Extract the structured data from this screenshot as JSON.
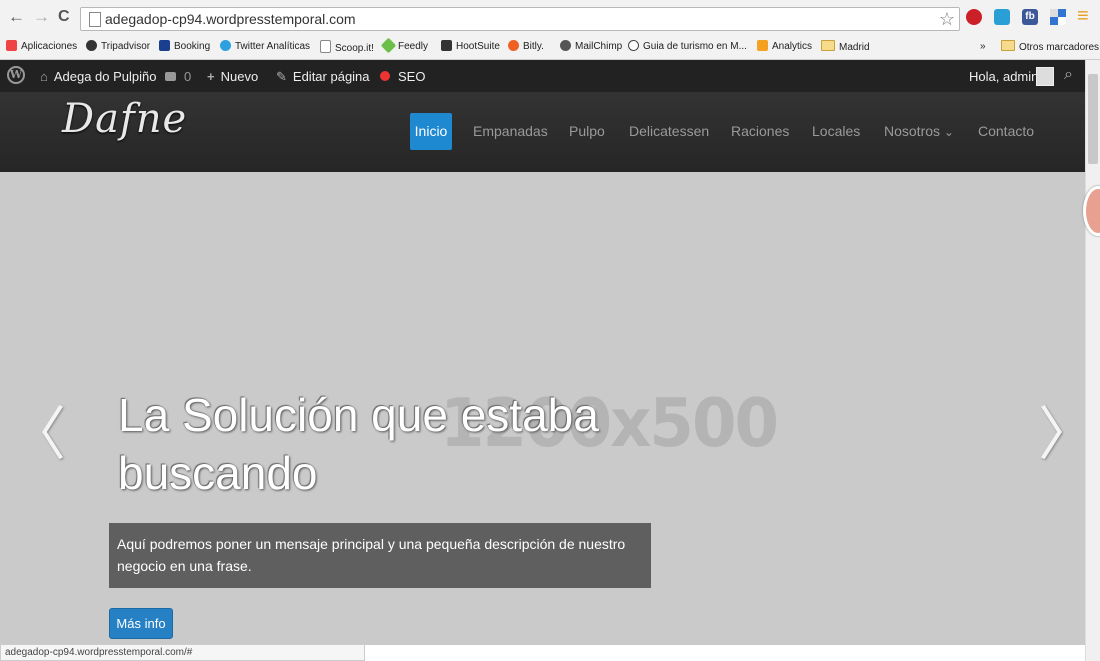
{
  "browser": {
    "url": "adegadop-cp94.wordpresstemporal.com",
    "status_url": "adegadop-cp94.wordpresstemporal.com/#",
    "back_icon": "←",
    "forward_icon": "→",
    "reload_icon": "C",
    "star_icon": "☆",
    "menu_icon": "≡",
    "ext_fb_label": "fb",
    "overflow_label": "»"
  },
  "bookmarks": [
    {
      "label": "Aplicaciones",
      "icon": "apps-icon",
      "color": "#e44"
    },
    {
      "label": "Tripadvisor",
      "icon": "tripadvisor-icon",
      "color": "#333"
    },
    {
      "label": "Booking",
      "icon": "booking-icon",
      "color": "#1a3f8f"
    },
    {
      "label": "Twitter Analíticas",
      "icon": "twitter-icon",
      "color": "#2ea0e0"
    },
    {
      "label": "Scoop.it!",
      "icon": "page-icon",
      "color": "#fff"
    },
    {
      "label": "Feedly",
      "icon": "feedly-icon",
      "color": "#6cc04a"
    },
    {
      "label": "HootSuite",
      "icon": "hootsuite-icon",
      "color": "#333"
    },
    {
      "label": "Bitly.",
      "icon": "bitly-icon",
      "color": "#ee6123"
    },
    {
      "label": "MailChimp",
      "icon": "mailchimp-icon",
      "color": "#555"
    },
    {
      "label": "Guia de turismo en M...",
      "icon": "guia-icon",
      "color": "#444"
    },
    {
      "label": "Analytics",
      "icon": "analytics-icon",
      "color": "#f4a020"
    },
    {
      "label": "Madrid",
      "icon": "folder-icon",
      "color": "#f6dc8a"
    }
  ],
  "bookmarks_other": "Otros marcadores",
  "adminbar": {
    "wp_logo": "W",
    "site": "Adega do Pulpiño",
    "comments": "0",
    "new": "Nuevo",
    "edit": "Editar página",
    "seo": "SEO",
    "greeting": "Hola, admin",
    "search_icon": "⌕"
  },
  "site": {
    "logo": "Dafne",
    "menu": [
      "Inicio",
      "Empanadas",
      "Pulpo",
      "Delicatessen",
      "Raciones",
      "Locales",
      "Nosotros",
      "Contacto"
    ],
    "dropdown_icon": "⌄"
  },
  "hero": {
    "placeholder": "1200x500",
    "headline": "La Solución que estaba buscando",
    "caption": "Aquí podremos poner un mensaje principal y una pequeña descripción de nuestro negocio en una frase.",
    "button": "Más info",
    "prev": "〈",
    "next": "〉"
  },
  "colors": {
    "accent": "#1e88d1",
    "adminbar": "#222222",
    "header": "#2e2e2e",
    "hero_bg": "#cacaca"
  }
}
